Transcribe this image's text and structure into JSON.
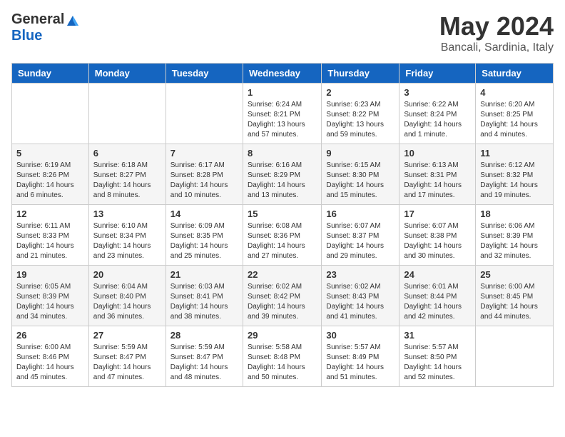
{
  "logo": {
    "general": "General",
    "blue": "Blue"
  },
  "title": "May 2024",
  "location": "Bancali, Sardinia, Italy",
  "days_of_week": [
    "Sunday",
    "Monday",
    "Tuesday",
    "Wednesday",
    "Thursday",
    "Friday",
    "Saturday"
  ],
  "weeks": [
    [
      {
        "day": "",
        "info": ""
      },
      {
        "day": "",
        "info": ""
      },
      {
        "day": "",
        "info": ""
      },
      {
        "day": "1",
        "info": "Sunrise: 6:24 AM\nSunset: 8:21 PM\nDaylight: 13 hours\nand 57 minutes."
      },
      {
        "day": "2",
        "info": "Sunrise: 6:23 AM\nSunset: 8:22 PM\nDaylight: 13 hours\nand 59 minutes."
      },
      {
        "day": "3",
        "info": "Sunrise: 6:22 AM\nSunset: 8:24 PM\nDaylight: 14 hours\nand 1 minute."
      },
      {
        "day": "4",
        "info": "Sunrise: 6:20 AM\nSunset: 8:25 PM\nDaylight: 14 hours\nand 4 minutes."
      }
    ],
    [
      {
        "day": "5",
        "info": "Sunrise: 6:19 AM\nSunset: 8:26 PM\nDaylight: 14 hours\nand 6 minutes."
      },
      {
        "day": "6",
        "info": "Sunrise: 6:18 AM\nSunset: 8:27 PM\nDaylight: 14 hours\nand 8 minutes."
      },
      {
        "day": "7",
        "info": "Sunrise: 6:17 AM\nSunset: 8:28 PM\nDaylight: 14 hours\nand 10 minutes."
      },
      {
        "day": "8",
        "info": "Sunrise: 6:16 AM\nSunset: 8:29 PM\nDaylight: 14 hours\nand 13 minutes."
      },
      {
        "day": "9",
        "info": "Sunrise: 6:15 AM\nSunset: 8:30 PM\nDaylight: 14 hours\nand 15 minutes."
      },
      {
        "day": "10",
        "info": "Sunrise: 6:13 AM\nSunset: 8:31 PM\nDaylight: 14 hours\nand 17 minutes."
      },
      {
        "day": "11",
        "info": "Sunrise: 6:12 AM\nSunset: 8:32 PM\nDaylight: 14 hours\nand 19 minutes."
      }
    ],
    [
      {
        "day": "12",
        "info": "Sunrise: 6:11 AM\nSunset: 8:33 PM\nDaylight: 14 hours\nand 21 minutes."
      },
      {
        "day": "13",
        "info": "Sunrise: 6:10 AM\nSunset: 8:34 PM\nDaylight: 14 hours\nand 23 minutes."
      },
      {
        "day": "14",
        "info": "Sunrise: 6:09 AM\nSunset: 8:35 PM\nDaylight: 14 hours\nand 25 minutes."
      },
      {
        "day": "15",
        "info": "Sunrise: 6:08 AM\nSunset: 8:36 PM\nDaylight: 14 hours\nand 27 minutes."
      },
      {
        "day": "16",
        "info": "Sunrise: 6:07 AM\nSunset: 8:37 PM\nDaylight: 14 hours\nand 29 minutes."
      },
      {
        "day": "17",
        "info": "Sunrise: 6:07 AM\nSunset: 8:38 PM\nDaylight: 14 hours\nand 30 minutes."
      },
      {
        "day": "18",
        "info": "Sunrise: 6:06 AM\nSunset: 8:39 PM\nDaylight: 14 hours\nand 32 minutes."
      }
    ],
    [
      {
        "day": "19",
        "info": "Sunrise: 6:05 AM\nSunset: 8:39 PM\nDaylight: 14 hours\nand 34 minutes."
      },
      {
        "day": "20",
        "info": "Sunrise: 6:04 AM\nSunset: 8:40 PM\nDaylight: 14 hours\nand 36 minutes."
      },
      {
        "day": "21",
        "info": "Sunrise: 6:03 AM\nSunset: 8:41 PM\nDaylight: 14 hours\nand 38 minutes."
      },
      {
        "day": "22",
        "info": "Sunrise: 6:02 AM\nSunset: 8:42 PM\nDaylight: 14 hours\nand 39 minutes."
      },
      {
        "day": "23",
        "info": "Sunrise: 6:02 AM\nSunset: 8:43 PM\nDaylight: 14 hours\nand 41 minutes."
      },
      {
        "day": "24",
        "info": "Sunrise: 6:01 AM\nSunset: 8:44 PM\nDaylight: 14 hours\nand 42 minutes."
      },
      {
        "day": "25",
        "info": "Sunrise: 6:00 AM\nSunset: 8:45 PM\nDaylight: 14 hours\nand 44 minutes."
      }
    ],
    [
      {
        "day": "26",
        "info": "Sunrise: 6:00 AM\nSunset: 8:46 PM\nDaylight: 14 hours\nand 45 minutes."
      },
      {
        "day": "27",
        "info": "Sunrise: 5:59 AM\nSunset: 8:47 PM\nDaylight: 14 hours\nand 47 minutes."
      },
      {
        "day": "28",
        "info": "Sunrise: 5:59 AM\nSunset: 8:47 PM\nDaylight: 14 hours\nand 48 minutes."
      },
      {
        "day": "29",
        "info": "Sunrise: 5:58 AM\nSunset: 8:48 PM\nDaylight: 14 hours\nand 50 minutes."
      },
      {
        "day": "30",
        "info": "Sunrise: 5:57 AM\nSunset: 8:49 PM\nDaylight: 14 hours\nand 51 minutes."
      },
      {
        "day": "31",
        "info": "Sunrise: 5:57 AM\nSunset: 8:50 PM\nDaylight: 14 hours\nand 52 minutes."
      },
      {
        "day": "",
        "info": ""
      }
    ]
  ]
}
